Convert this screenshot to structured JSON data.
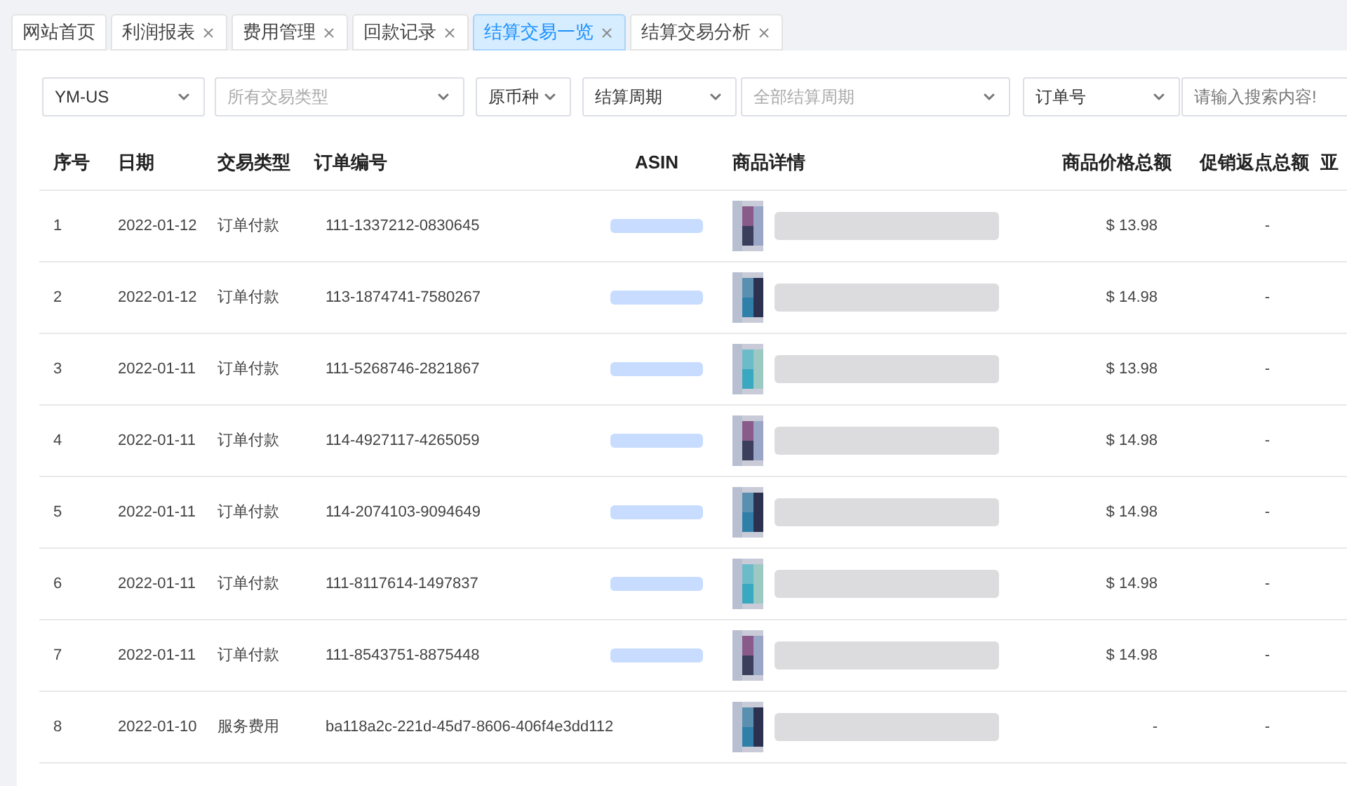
{
  "tabs": [
    {
      "label": "网站首页",
      "closable": false,
      "selected": false
    },
    {
      "label": "利润报表",
      "closable": true,
      "selected": false
    },
    {
      "label": "费用管理",
      "closable": true,
      "selected": false
    },
    {
      "label": "回款记录",
      "closable": true,
      "selected": false
    },
    {
      "label": "结算交易一览",
      "closable": true,
      "selected": true
    },
    {
      "label": "结算交易分析",
      "closable": true,
      "selected": false
    }
  ],
  "filters": [
    {
      "kind": "select",
      "value": "YM-US"
    },
    {
      "kind": "select",
      "placeholder": "所有交易类型"
    },
    {
      "kind": "select",
      "value": "原币种"
    },
    {
      "kind": "select",
      "value": "结算周期"
    },
    {
      "kind": "select",
      "placeholder": "全部结算周期"
    },
    {
      "kind": "select",
      "value": "订单号"
    },
    {
      "kind": "input",
      "placeholder": "请输入搜索内容!"
    }
  ],
  "table": {
    "columns": [
      "序号",
      "日期",
      "交易类型",
      "订单编号",
      "ASIN",
      "商品详情",
      "商品价格总额",
      "促销返点总额",
      "亚"
    ],
    "rows": [
      {
        "index": "1",
        "date": "2022-01-12",
        "type": "订单付款",
        "order": "111-1337212-0830645",
        "price": "$ 13.98",
        "rebate": "-"
      },
      {
        "index": "2",
        "date": "2022-01-12",
        "type": "订单付款",
        "order": "113-1874741-7580267",
        "price": "$ 14.98",
        "rebate": "-"
      },
      {
        "index": "3",
        "date": "2022-01-11",
        "type": "订单付款",
        "order": "111-5268746-2821867",
        "price": "$ 13.98",
        "rebate": "-"
      },
      {
        "index": "4",
        "date": "2022-01-11",
        "type": "订单付款",
        "order": "114-4927117-4265059",
        "price": "$ 14.98",
        "rebate": "-"
      },
      {
        "index": "5",
        "date": "2022-01-11",
        "type": "订单付款",
        "order": "114-2074103-9094649",
        "price": "$ 14.98",
        "rebate": "-"
      },
      {
        "index": "6",
        "date": "2022-01-11",
        "type": "订单付款",
        "order": "111-8117614-1497837",
        "price": "$ 14.98",
        "rebate": "-"
      },
      {
        "index": "7",
        "date": "2022-01-11",
        "type": "订单付款",
        "order": "111-8543751-8875448",
        "price": "$ 14.98",
        "rebate": "-"
      },
      {
        "index": "8",
        "date": "2022-01-10",
        "type": "服务费用",
        "order": "ba118a2c-221d-45d7-8606-406f4e3dd112",
        "price": "-",
        "rebate": "-"
      }
    ]
  }
}
